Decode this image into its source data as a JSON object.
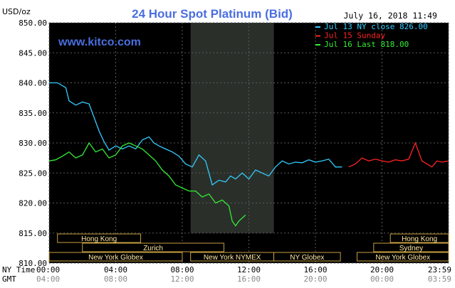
{
  "title": "24 Hour Spot Platinum (Bid)",
  "timestamp": "July 16, 2018 11:49",
  "watermark": "www.kitco.com",
  "y_unit_label": "USD/oz",
  "x_row_labels": {
    "ny": "NY Time",
    "gmt": "GMT"
  },
  "colors": {
    "background": "#000000",
    "grid": "#5a5a5a",
    "title": "#4a6ee0",
    "watermark": "#4a6ee0",
    "jul13": "#33ccff",
    "jul15": "#ff2222",
    "jul16": "#33ee33",
    "axis_text": "#000000",
    "gmt_text": "#888888",
    "market_box_fill": "#000000",
    "market_box_border": "#c8a040",
    "market_box_text": "#ffe9a0",
    "shade": "#2a2f2a"
  },
  "legend": [
    {
      "label": "Jul 13 NY close 826.00",
      "color_key": "jul13"
    },
    {
      "label": "Jul 15 Sunday",
      "color_key": "jul15"
    },
    {
      "label": "Jul 16 Last 818.00",
      "color_key": "jul16"
    }
  ],
  "markets": [
    {
      "label": "Hong Kong",
      "row": 0,
      "start": 0.5,
      "end": 5.5
    },
    {
      "label": "Hong Kong",
      "row": 0,
      "start": 20.5,
      "end": 24
    },
    {
      "label": "Zurich",
      "row": 1,
      "start": 2,
      "end": 10.5
    },
    {
      "label": "Sydney",
      "row": 1,
      "start": 19.5,
      "end": 24
    },
    {
      "label": "New York Globex",
      "row": 2,
      "start": 0,
      "end": 8
    },
    {
      "label": "New York NYMEX",
      "row": 2,
      "start": 8.5,
      "end": 13.5
    },
    {
      "label": "NY Globex",
      "row": 2,
      "start": 13.5,
      "end": 17.5
    },
    {
      "label": "New York Globex",
      "row": 2,
      "start": 18.5,
      "end": 24
    }
  ],
  "chart_data": {
    "type": "line",
    "title": "24 Hour Spot Platinum (Bid)",
    "ylabel": "USD/oz",
    "ylim": [
      810,
      850
    ],
    "xlim": [
      0,
      24
    ],
    "y_ticks": [
      850,
      845,
      840,
      835,
      830,
      825,
      820,
      815,
      810
    ],
    "y_tick_labels": [
      "850.00",
      "845.00",
      "840.00",
      "835.00",
      "830.00",
      "825.00",
      "820.00",
      "815.00",
      "810.00"
    ],
    "x_ticks": [
      0,
      4,
      8,
      12,
      16,
      20,
      24
    ],
    "x_tick_labels_ny": [
      "00:00",
      "04:00",
      "08:00",
      "12:00",
      "16:00",
      "20:00",
      "23:59"
    ],
    "x_tick_labels_gmt": [
      "04:00",
      "08:00",
      "12:00",
      "16:00",
      "20:00",
      "00:00",
      "03:59"
    ],
    "shaded_region": [
      8.5,
      13.5
    ],
    "grid": true,
    "legend_position": "top-right",
    "series": [
      {
        "name": "Jul 13 NY close 826.00",
        "color_key": "jul13",
        "x": [
          0,
          0.5,
          1.0,
          1.2,
          1.6,
          2.0,
          2.4,
          3.0,
          3.3,
          3.6,
          4.0,
          4.4,
          4.8,
          5.2,
          5.6,
          6.0,
          6.3,
          6.6,
          7.0,
          7.4,
          7.8,
          8.2,
          8.6,
          9.0,
          9.4,
          9.8,
          10.2,
          10.6,
          10.9,
          11.2,
          11.6,
          12.0,
          12.4,
          12.8,
          13.2,
          13.6,
          14.0,
          14.4,
          14.8,
          15.2,
          15.6,
          16.0,
          16.4,
          16.8,
          17.2,
          17.6
        ],
        "values": [
          840.0,
          840.0,
          839.2,
          837.0,
          836.3,
          836.8,
          836.5,
          832.0,
          830.2,
          828.8,
          829.5,
          829.0,
          829.5,
          829.0,
          830.5,
          831.0,
          830.0,
          829.5,
          829.0,
          828.5,
          827.8,
          826.5,
          826.0,
          828.0,
          827.0,
          823.0,
          823.8,
          823.5,
          824.5,
          824.0,
          825.0,
          824.0,
          825.5,
          825.0,
          824.5,
          826.0,
          827.0,
          826.5,
          826.8,
          826.7,
          827.2,
          826.8,
          827.0,
          827.3,
          826.0,
          826.0
        ]
      },
      {
        "name": "Jul 15 Sunday",
        "color_key": "jul15",
        "x": [
          18.0,
          18.4,
          18.8,
          19.2,
          19.6,
          20.0,
          20.4,
          20.8,
          21.2,
          21.6,
          22.0,
          22.4,
          22.7,
          23.0,
          23.3,
          23.6,
          23.99
        ],
        "values": [
          826.0,
          826.5,
          827.5,
          827.0,
          827.3,
          827.0,
          826.8,
          827.2,
          827.0,
          827.3,
          830.0,
          827.0,
          826.5,
          826.0,
          827.0,
          826.8,
          827.0
        ]
      },
      {
        "name": "Jul 16 Last 818.00",
        "color_key": "jul16",
        "x": [
          0,
          0.4,
          0.8,
          1.2,
          1.6,
          2.0,
          2.4,
          2.8,
          3.2,
          3.6,
          4.0,
          4.4,
          4.8,
          5.2,
          5.6,
          6.0,
          6.4,
          6.8,
          7.2,
          7.6,
          8.0,
          8.4,
          8.8,
          9.2,
          9.6,
          10.0,
          10.4,
          10.8,
          11.0,
          11.2,
          11.4,
          11.6,
          11.8
        ],
        "values": [
          827.0,
          827.2,
          827.8,
          828.5,
          827.5,
          828.0,
          830.0,
          828.5,
          829.0,
          827.5,
          828.0,
          829.5,
          830.0,
          829.5,
          829.0,
          828.0,
          827.0,
          825.5,
          824.5,
          823.0,
          822.5,
          822.0,
          822.0,
          821.0,
          821.5,
          820.0,
          820.5,
          819.5,
          817.0,
          816.2,
          817.0,
          817.5,
          818.0
        ]
      }
    ]
  }
}
